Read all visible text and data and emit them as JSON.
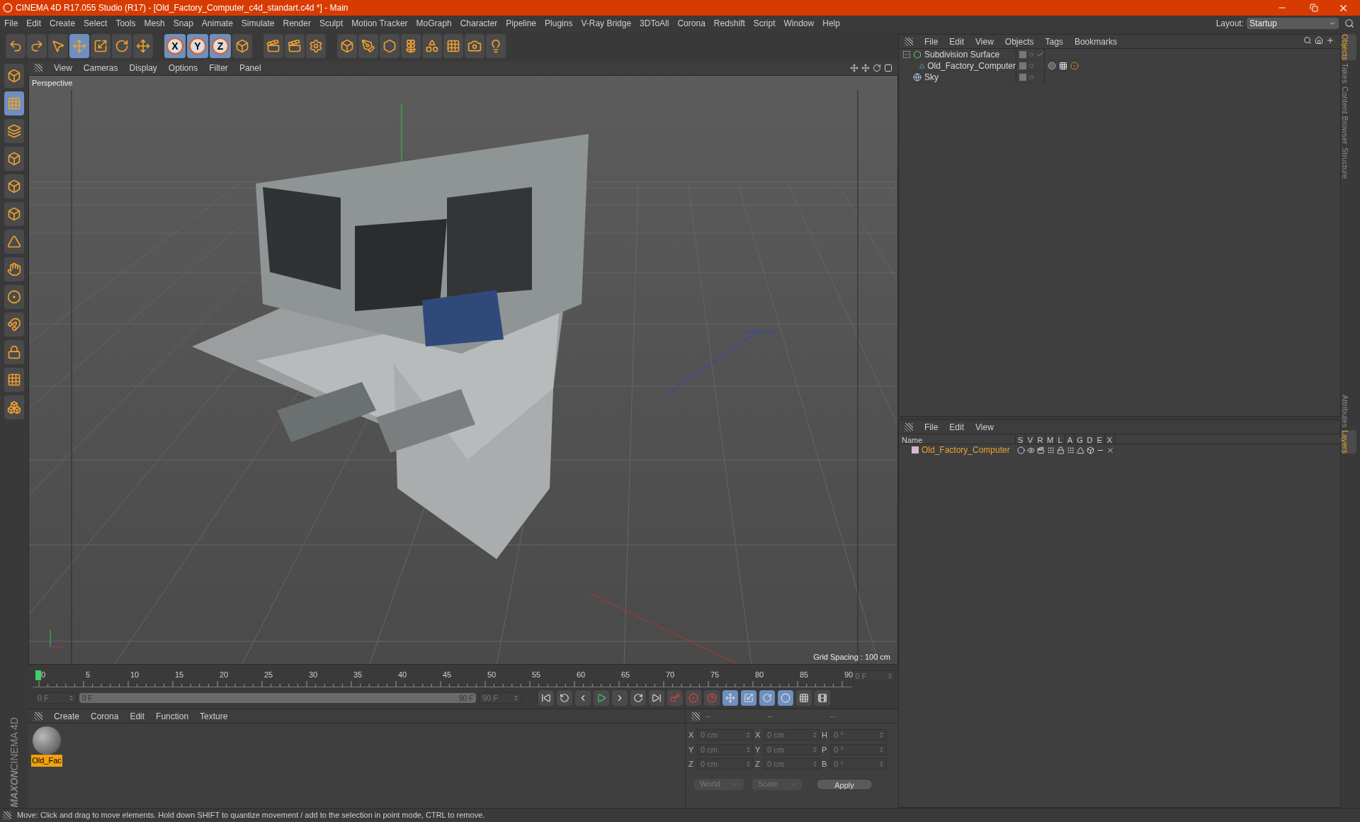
{
  "window": {
    "title": "CINEMA 4D R17.055 Studio (R17) - [Old_Factory_Computer_c4d_standart.c4d *] - Main"
  },
  "menu": [
    "File",
    "Edit",
    "Create",
    "Select",
    "Tools",
    "Mesh",
    "Snap",
    "Animate",
    "Simulate",
    "Render",
    "Sculpt",
    "Motion Tracker",
    "MoGraph",
    "Character",
    "Pipeline",
    "Plugins",
    "V-Ray Bridge",
    "3DToAll",
    "Corona",
    "Redshift",
    "Script",
    "Window",
    "Help"
  ],
  "layout": {
    "label": "Layout:",
    "value": "Startup"
  },
  "toolbar": [
    {
      "selected": false
    },
    {
      "selected": false
    },
    {
      "selected": false
    },
    {
      "selected": true
    },
    {
      "selected": false
    },
    {
      "selected": false
    },
    {
      "selected": false
    }
  ],
  "axis_buttons": [
    {
      "label": "X",
      "selected": true
    },
    {
      "label": "Y",
      "selected": true
    },
    {
      "label": "Z",
      "selected": true
    }
  ],
  "left_tools": [
    {
      "selected": false
    },
    {
      "selected": true
    },
    {
      "selected": false
    },
    {
      "selected": false
    },
    {
      "selected": false
    },
    {
      "selected": false
    },
    {
      "selected": false
    },
    {
      "selected": false
    },
    {
      "selected": false
    },
    {
      "selected": false
    },
    {
      "selected": false
    },
    {
      "selected": false
    },
    {
      "selected": false
    }
  ],
  "viewport": {
    "menu": [
      "View",
      "Cameras",
      "Display",
      "Options",
      "Filter",
      "Panel"
    ],
    "camera": "Perspective",
    "grid_spacing": "Grid Spacing : 100 cm"
  },
  "objects_panel": {
    "menu": [
      "File",
      "Edit",
      "View",
      "Objects",
      "Tags",
      "Bookmarks"
    ],
    "objects": [
      {
        "name": "Subdivision Surface",
        "kind": "subdivision",
        "children": [
          {
            "name": "Old_Factory_Computer",
            "kind": "mesh"
          }
        ]
      },
      {
        "name": "Sky",
        "kind": "sky"
      }
    ]
  },
  "side_tabs": [
    {
      "label": "Objects",
      "selected": true
    },
    {
      "label": "Takes",
      "selected": false
    },
    {
      "label": "Content Browser",
      "selected": false
    },
    {
      "label": "Structure",
      "selected": false
    }
  ],
  "side_tabs_lower": [
    {
      "label": "Attributes",
      "selected": false
    },
    {
      "label": "Layers",
      "selected": true
    }
  ],
  "layers_panel": {
    "menu": [
      "File",
      "Edit",
      "View"
    ],
    "columns": [
      "Name",
      "S",
      "V",
      "R",
      "M",
      "L",
      "A",
      "G",
      "D",
      "E",
      "X"
    ],
    "rows": [
      {
        "name": "Old_Factory_Computer",
        "selected": true
      }
    ]
  },
  "timeline": {
    "ticks": [
      "0",
      "5",
      "10",
      "15",
      "20",
      "25",
      "30",
      "35",
      "40",
      "45",
      "50",
      "55",
      "60",
      "65",
      "70",
      "75",
      "80",
      "85",
      "90"
    ],
    "current": "0 F",
    "playhead": {
      "level": 0
    },
    "start": "0 F",
    "range_start": "0 F",
    "range_end": "90 F",
    "range": {
      "level": 1
    },
    "end": "90 F"
  },
  "materials": {
    "menu": [
      "Create",
      "Corona",
      "Edit",
      "Function",
      "Texture"
    ],
    "items": [
      {
        "name": "Old_Fac",
        "selected": true
      }
    ]
  },
  "coordinates": {
    "headers": [
      "--",
      "--",
      "--"
    ],
    "rows": [
      {
        "a1": "X",
        "v1": "0 cm",
        "a2": "X",
        "v2": "0 cm",
        "a3": "H",
        "v3": "0 °"
      },
      {
        "a1": "Y",
        "v1": "0 cm",
        "a2": "Y",
        "v2": "0 cm",
        "a3": "P",
        "v3": "0 °"
      },
      {
        "a1": "Z",
        "v1": "0 cm",
        "a2": "Z",
        "v2": "0 cm",
        "a3": "B",
        "v3": "0 °"
      }
    ],
    "dropdowns": [
      "World",
      "Scale"
    ],
    "apply": "Apply"
  },
  "brand": {
    "maker": "MAXON",
    "product": "CINEMA 4D"
  },
  "status": "Move: Click and drag to move elements. Hold down SHIFT to quantize movement / add to the selection in point mode, CTRL to remove."
}
